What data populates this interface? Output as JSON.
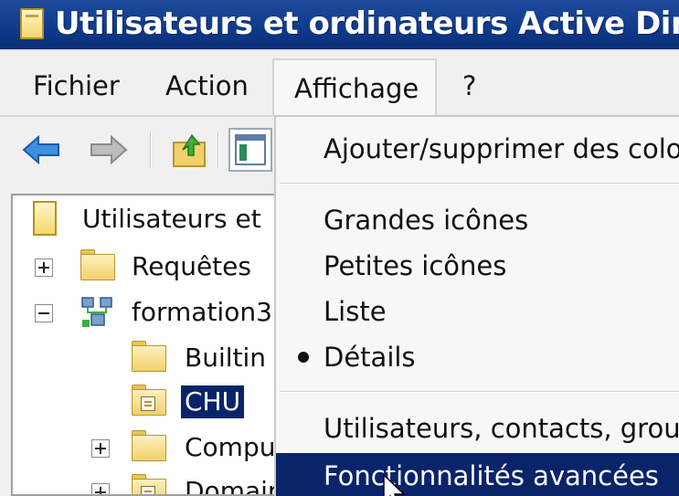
{
  "window": {
    "title": "Utilisateurs et ordinateurs Active Direct"
  },
  "menubar": {
    "items": [
      "Fichier",
      "Action",
      "Affichage",
      "?"
    ]
  },
  "toolbar": {
    "icons": [
      "back-arrow-icon",
      "forward-arrow-icon",
      "up-folder-icon",
      "console-tree-icon"
    ]
  },
  "tree": {
    "root_label": "Utilisateurs et",
    "items": [
      {
        "label": "Requêtes",
        "expander": "plus",
        "icon": "folder-icon"
      },
      {
        "label": "formation3",
        "expander": "minus",
        "icon": "domain-icon"
      },
      {
        "label": "Builtin",
        "expander": "none",
        "icon": "folder-icon"
      },
      {
        "label": "CHU",
        "expander": "none",
        "icon": "ou-folder-icon",
        "selected": true
      },
      {
        "label": "Compu",
        "expander": "plus",
        "icon": "folder-icon"
      },
      {
        "label": "Domair",
        "expander": "plus",
        "icon": "ou-folder-icon"
      }
    ]
  },
  "affichage_menu": {
    "add_remove_columns": "Ajouter/supprimer des colon",
    "large_icons": "Grandes icônes",
    "small_icons": "Petites icônes",
    "list": "Liste",
    "details": "Détails",
    "users_contacts_groups": "Utilisateurs, contacts, grou",
    "advanced_features": "Fonctionnalités avancées"
  },
  "colors": {
    "title_bar": "#0d3a8a",
    "selection": "#0a246a",
    "menu_bg": "#f0f0f0",
    "folder": "#f2d06b"
  }
}
